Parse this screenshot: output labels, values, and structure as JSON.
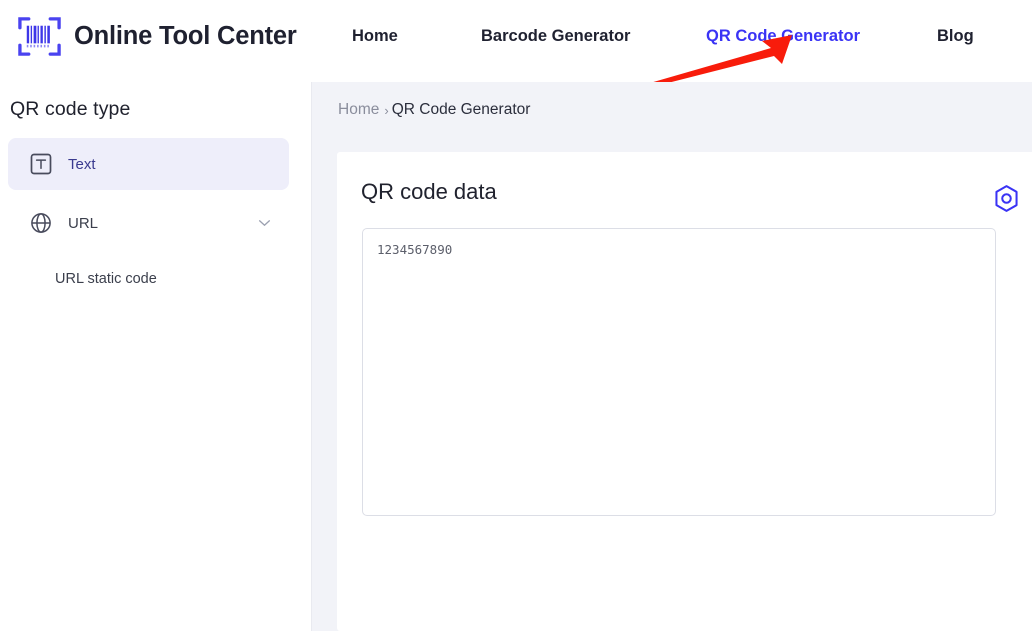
{
  "brand": {
    "name": "Online Tool Center",
    "logo_icon": "barcode-scanner-icon"
  },
  "nav": {
    "items": [
      {
        "label": "Home",
        "active": false
      },
      {
        "label": "Barcode Generator",
        "active": false
      },
      {
        "label": "QR Code Generator",
        "active": true
      },
      {
        "label": "Blog",
        "active": false
      }
    ],
    "active_color": "#3a33f5",
    "text_color": "#1f2130"
  },
  "annotation": {
    "arrow_color": "#f81c0b",
    "points_to": "QR Code Generator"
  },
  "sidebar": {
    "title": "QR code type",
    "items": [
      {
        "label": "Text",
        "icon": "text-box-icon",
        "selected": true,
        "highlight_color": "#eeeefa",
        "label_color": "#3a3a8f"
      },
      {
        "label": "URL",
        "icon": "globe-icon",
        "selected": false,
        "expandable": true,
        "chevron": "chevron-down-icon",
        "label_color": "#3b3f4c"
      }
    ],
    "sub_items": [
      {
        "label": "URL static code"
      }
    ]
  },
  "breadcrumb": {
    "home": "Home",
    "separator": "›",
    "current": "QR Code Generator"
  },
  "card": {
    "title": "QR code data",
    "gear_icon": "hex-nut-settings-icon",
    "gear_color": "#3a33f5",
    "textarea": {
      "value": "1234567890",
      "placeholder": "1234567890"
    }
  },
  "colors": {
    "page_background": "#ffffff",
    "content_background": "#f2f3f8",
    "card_background": "#ffffff",
    "accent": "#3a33f5",
    "border": "#dcdee6"
  }
}
